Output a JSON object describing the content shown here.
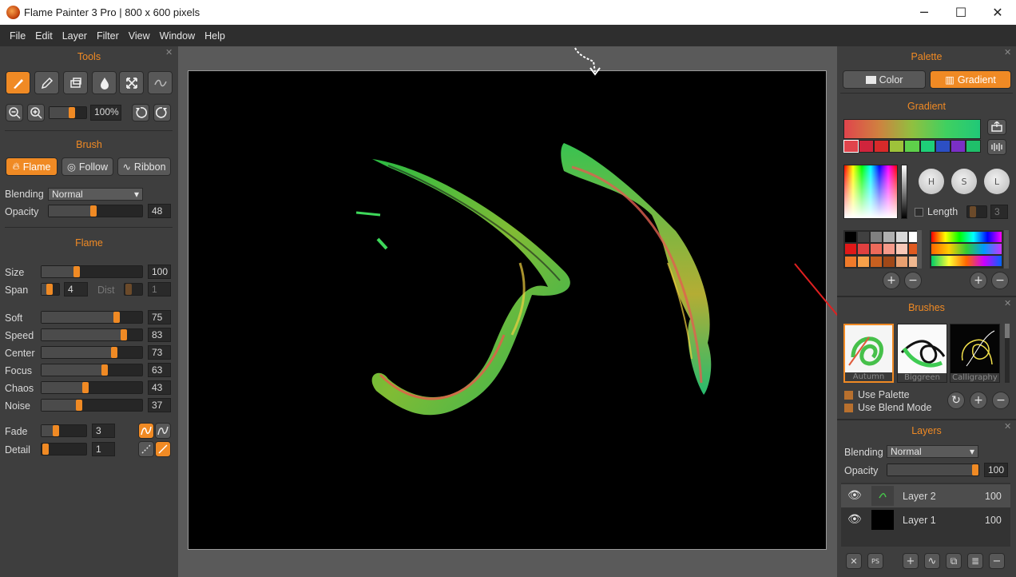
{
  "window": {
    "title": "Flame Painter 3 Pro | 800 x 600 pixels",
    "minimize_glyph": "─",
    "maximize_glyph": "☐",
    "close_glyph": "✕"
  },
  "menu": [
    "File",
    "Edit",
    "Layer",
    "Filter",
    "View",
    "Window",
    "Help"
  ],
  "tools": {
    "title": "Tools",
    "zoom_value": "100%",
    "zoom_level": 0.25,
    "items": [
      "flame-brush-tool",
      "pencil-tool",
      "eraser-tool",
      "blur-drop-tool",
      "transform-tool",
      "smooth-wave-tool"
    ]
  },
  "brush": {
    "title": "Brush",
    "modes": [
      "Flame",
      "Follow",
      "Ribbon"
    ],
    "active_mode": "Flame",
    "blending_label": "Blending",
    "blending_value": "Normal",
    "opacity_label": "Opacity",
    "opacity_value": "48"
  },
  "flame": {
    "title": "Flame",
    "size_label": "Size",
    "size_value": "100",
    "span_label": "Span",
    "span_value": "4",
    "dist_label": "Dist",
    "dist_value": "1",
    "soft_label": "Soft",
    "soft_value": "75",
    "speed_label": "Speed",
    "speed_value": "83",
    "center_label": "Center",
    "center_value": "73",
    "focus_label": "Focus",
    "focus_value": "63",
    "chaos_label": "Chaos",
    "chaos_value": "43",
    "noise_label": "Noise",
    "noise_value": "37",
    "fade_label": "Fade",
    "fade_value": "3",
    "detail_label": "Detail",
    "detail_value": "1"
  },
  "palette": {
    "title": "Palette",
    "color_tab": "Color",
    "gradient_tab": "Gradient",
    "gradient_title": "Gradient",
    "length_label": "Length",
    "length_value": "3",
    "h_label": "H",
    "s_label": "S",
    "l_label": "L",
    "gradient_stops": [
      "#e0444c",
      "#d0243c",
      "#d82a2a",
      "#9ec23a",
      "#5ed04a",
      "#1ecf78",
      "#2c4fc4",
      "#7a2fc6",
      "#1fbf6a"
    ],
    "swatches": [
      "#000000",
      "#404040",
      "#808080",
      "#b0b0b0",
      "#d8d8d8",
      "#ffffff",
      "#e01818",
      "#e04040",
      "#ee6a5a",
      "#f59a8a",
      "#f8c8b8",
      "#e05a20",
      "#f07a2a",
      "#f6a04a",
      "#c86020",
      "#a04818",
      "#e8a070",
      "#f0b890"
    ]
  },
  "brushes": {
    "title": "Brushes",
    "items": [
      "Autumn",
      "Biggreen",
      "Calligraphy"
    ],
    "use_palette": "Use Palette",
    "use_blend_mode": "Use Blend Mode"
  },
  "layers": {
    "title": "Layers",
    "blending_label": "Blending",
    "blending_value": "Normal",
    "opacity_label": "Opacity",
    "opacity_value": "100",
    "list": [
      {
        "name": "Layer 2",
        "opacity": "100"
      },
      {
        "name": "Layer 1",
        "opacity": "100"
      }
    ]
  },
  "colors": {
    "accent": "#f08a24",
    "panel": "#3e3e3e",
    "canvas": "#000000",
    "workspace": "#5a5a5a",
    "annotation_arrow": "#e02020"
  }
}
